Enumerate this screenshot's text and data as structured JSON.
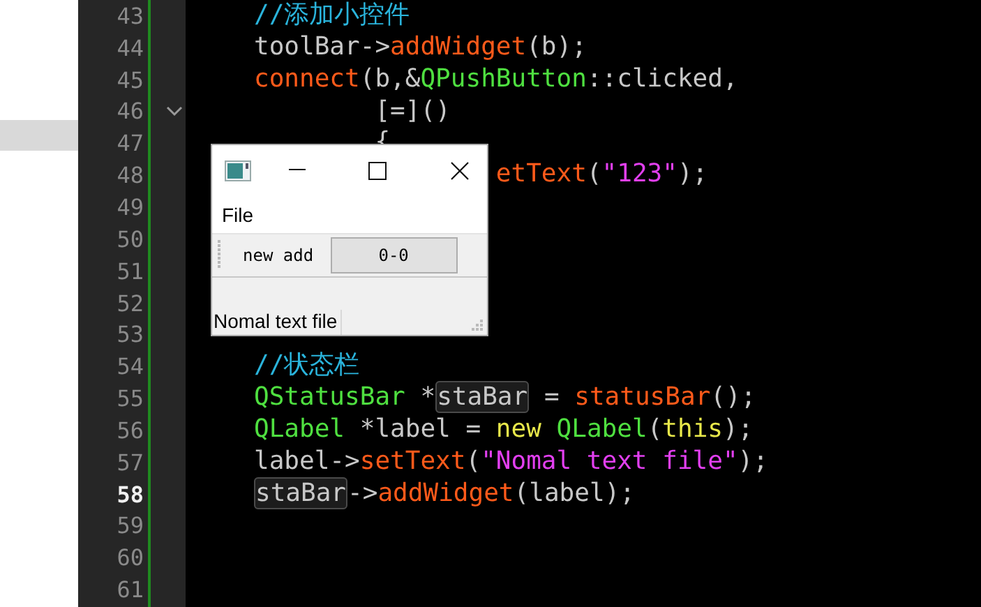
{
  "editor": {
    "lines": [
      {
        "number": "43",
        "current": false,
        "fold": false,
        "tokens": [
          {
            "kind": "comment",
            "text": "//添加小控件"
          }
        ]
      },
      {
        "number": "44",
        "current": false,
        "fold": false,
        "tokens": [
          {
            "kind": "plain",
            "text": "toolBar->"
          },
          {
            "kind": "func",
            "text": "addWidget"
          },
          {
            "kind": "plain",
            "text": "(b);"
          }
        ]
      },
      {
        "number": "45",
        "current": false,
        "fold": false,
        "tokens": [
          {
            "kind": "func",
            "text": "connect"
          },
          {
            "kind": "plain",
            "text": "(b,&"
          },
          {
            "kind": "type",
            "text": "QPushButton"
          },
          {
            "kind": "plain",
            "text": "::clicked,"
          }
        ]
      },
      {
        "number": "46",
        "current": false,
        "fold": true,
        "tokens": [
          {
            "kind": "plain",
            "text": "        [=]()"
          }
        ]
      },
      {
        "number": "47",
        "current": false,
        "fold": false,
        "tokens": [
          {
            "kind": "plain",
            "text": "        {"
          }
        ]
      },
      {
        "number": "48",
        "current": false,
        "fold": false,
        "tokens": [
          {
            "kind": "func",
            "text": "                etText"
          },
          {
            "kind": "plain",
            "text": "("
          },
          {
            "kind": "string",
            "text": "\"123\""
          },
          {
            "kind": "plain",
            "text": ");"
          }
        ]
      },
      {
        "number": "49",
        "current": false,
        "fold": false
      },
      {
        "number": "50",
        "current": false,
        "fold": false
      },
      {
        "number": "51",
        "current": false,
        "fold": false
      },
      {
        "number": "52",
        "current": false,
        "fold": false
      },
      {
        "number": "53",
        "current": false,
        "fold": false
      },
      {
        "number": "54",
        "current": false,
        "fold": false,
        "tokens": [
          {
            "kind": "comment",
            "text": "//状态栏"
          }
        ]
      },
      {
        "number": "55",
        "current": false,
        "fold": false,
        "tokens": [
          {
            "kind": "type",
            "text": "QStatusBar"
          },
          {
            "kind": "plain",
            "text": " *"
          },
          {
            "kind": "highlight",
            "text": "staBar"
          },
          {
            "kind": "plain",
            "text": " = "
          },
          {
            "kind": "func",
            "text": "statusBar"
          },
          {
            "kind": "plain",
            "text": "();"
          }
        ]
      },
      {
        "number": "56",
        "current": false,
        "fold": false,
        "tokens": [
          {
            "kind": "type",
            "text": "QLabel"
          },
          {
            "kind": "plain",
            "text": " *label = "
          },
          {
            "kind": "keyword",
            "text": "new"
          },
          {
            "kind": "type",
            "text": " QLabel"
          },
          {
            "kind": "plain",
            "text": "("
          },
          {
            "kind": "keyword",
            "text": "this"
          },
          {
            "kind": "plain",
            "text": ");"
          }
        ]
      },
      {
        "number": "57",
        "current": false,
        "fold": false,
        "tokens": [
          {
            "kind": "plain",
            "text": "label->"
          },
          {
            "kind": "func",
            "text": "setText"
          },
          {
            "kind": "plain",
            "text": "("
          },
          {
            "kind": "string",
            "text": "\"Nomal text file\""
          },
          {
            "kind": "plain",
            "text": ");"
          }
        ]
      },
      {
        "number": "58",
        "current": true,
        "fold": false,
        "tokens": [
          {
            "kind": "highlight",
            "text": "staBar"
          },
          {
            "kind": "plain",
            "text": "->"
          },
          {
            "kind": "func",
            "text": "addWidget"
          },
          {
            "kind": "plain",
            "text": "(label);"
          }
        ]
      },
      {
        "number": "59",
        "current": false,
        "fold": false
      },
      {
        "number": "60",
        "current": false,
        "fold": false
      },
      {
        "number": "61",
        "current": false,
        "fold": false
      }
    ]
  },
  "window": {
    "menu": [
      "File"
    ],
    "toolbar": {
      "label": "new add",
      "button": "0-0"
    },
    "status": "Nomal text file"
  }
}
